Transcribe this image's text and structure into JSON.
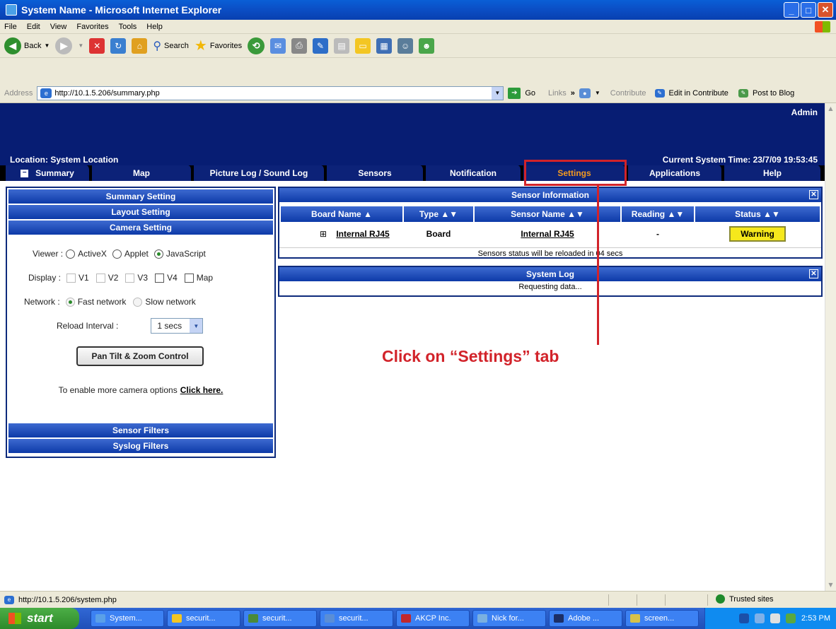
{
  "window": {
    "title": "System Name - Microsoft Internet Explorer"
  },
  "menubar": {
    "items": [
      "File",
      "Edit",
      "View",
      "Favorites",
      "Tools",
      "Help"
    ]
  },
  "toolbar": {
    "back_label": "Back",
    "search_label": "Search",
    "favorites_label": "Favorites"
  },
  "addressbar": {
    "label": "Address",
    "url": "http://10.1.5.206/summary.php",
    "go_label": "Go",
    "links_label": "Links",
    "chevrons": "»",
    "contribute_label": "Contribute",
    "edit_in_contribute": "Edit in Contribute",
    "post_to_blog": "Post to Blog"
  },
  "header": {
    "user": "Admin",
    "location": "Location: System Location",
    "time": "Current System Time: 23/7/09 19:53:45"
  },
  "tabs": [
    "Summary",
    "Map",
    "Picture Log / Sound Log",
    "Sensors",
    "Notification",
    "Settings",
    "Applications",
    "Help"
  ],
  "left_panel": {
    "summary_setting": "Summary Setting",
    "layout_setting": "Layout Setting",
    "camera_setting": "Camera Setting",
    "viewer_label": "Viewer :",
    "viewer_options": [
      "ActiveX",
      "Applet",
      "JavaScript"
    ],
    "viewer_selected": "JavaScript",
    "display_label": "Display :",
    "display_options": [
      "V1",
      "V2",
      "V3",
      "V4",
      "Map"
    ],
    "network_label": "Network :",
    "network_options": [
      "Fast network",
      "Slow network"
    ],
    "reload_label": "Reload Interval :",
    "reload_value": "1 secs",
    "ptz_button": "Pan Tilt & Zoom Control",
    "more_options_text": "To enable more camera options",
    "more_options_link": "Click here.",
    "sensor_filters": "Sensor Filters",
    "syslog_filters": "Syslog Filters"
  },
  "sensor_info": {
    "title": "Sensor Information",
    "columns": [
      "Board Name ▲",
      "Type ▲▼",
      "Sensor Name ▲▼",
      "Reading ▲▼",
      "Status ▲▼"
    ],
    "rows": [
      {
        "expand": "⊞",
        "board": "Internal RJ45",
        "type": "Board",
        "sensor": "Internal RJ45",
        "reading": "-",
        "status": "Warning"
      }
    ],
    "note": "Sensors status will be reloaded in 04 secs"
  },
  "system_log": {
    "title": "System Log",
    "message": "Requesting data..."
  },
  "callout": {
    "text": "Click on “Settings” tab"
  },
  "statusbar": {
    "url": "http://10.1.5.206/system.php",
    "zone": "Trusted sites"
  },
  "taskbar": {
    "start": "start",
    "tasks": [
      "System...",
      "securit...",
      "securit...",
      "securit...",
      "AKCP Inc.",
      "Nick for...",
      "Adobe ...",
      "screen..."
    ],
    "clock": "2:53 PM"
  },
  "colors": {
    "header_bg": "#071d73",
    "tab_bg": "#0c2278",
    "active_tab": "#f59a1f",
    "warning": "#f6e81c",
    "callout": "#d2232a"
  }
}
